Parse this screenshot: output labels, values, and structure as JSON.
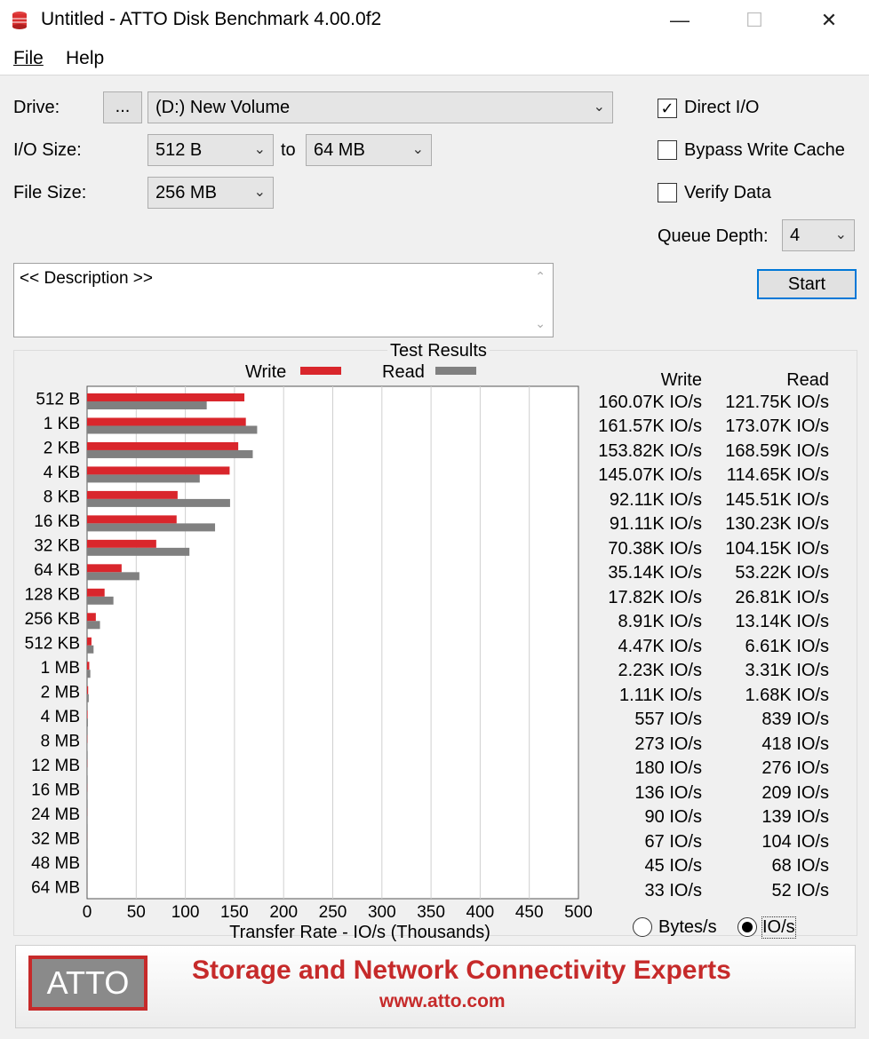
{
  "window": {
    "title": "Untitled - ATTO Disk Benchmark 4.00.0f2",
    "min": "—",
    "max": "☐",
    "close": "✕"
  },
  "menu": {
    "file": "File",
    "help": "Help"
  },
  "drive": {
    "label": "Drive:",
    "browse": "...",
    "value": "(D:) New Volume"
  },
  "io_size": {
    "label": "I/O Size:",
    "from": "512 B",
    "to_label": "to",
    "to": "64 MB"
  },
  "file_size": {
    "label": "File Size:",
    "value": "256 MB"
  },
  "options": {
    "direct_io": {
      "label": "Direct I/O",
      "checked": true
    },
    "bypass_write_cache": {
      "label": "Bypass Write Cache",
      "checked": false
    },
    "verify_data": {
      "label": "Verify Data",
      "checked": false
    },
    "queue_depth": {
      "label": "Queue Depth:",
      "value": "4"
    }
  },
  "start_label": "Start",
  "description": "<< Description >>",
  "results": {
    "title": "Test Results",
    "write_header": "Write",
    "read_header": "Read",
    "rows": [
      {
        "size": "512 B",
        "write": "160.07K IO/s",
        "read": "121.75K IO/s"
      },
      {
        "size": "1 KB",
        "write": "161.57K IO/s",
        "read": "173.07K IO/s"
      },
      {
        "size": "2 KB",
        "write": "153.82K IO/s",
        "read": "168.59K IO/s"
      },
      {
        "size": "4 KB",
        "write": "145.07K IO/s",
        "read": "114.65K IO/s"
      },
      {
        "size": "8 KB",
        "write": "92.11K IO/s",
        "read": "145.51K IO/s"
      },
      {
        "size": "16 KB",
        "write": "91.11K IO/s",
        "read": "130.23K IO/s"
      },
      {
        "size": "32 KB",
        "write": "70.38K IO/s",
        "read": "104.15K IO/s"
      },
      {
        "size": "64 KB",
        "write": "35.14K IO/s",
        "read": "53.22K IO/s"
      },
      {
        "size": "128 KB",
        "write": "17.82K IO/s",
        "read": "26.81K IO/s"
      },
      {
        "size": "256 KB",
        "write": "8.91K IO/s",
        "read": "13.14K IO/s"
      },
      {
        "size": "512 KB",
        "write": "4.47K IO/s",
        "read": "6.61K IO/s"
      },
      {
        "size": "1 MB",
        "write": "2.23K IO/s",
        "read": "3.31K IO/s"
      },
      {
        "size": "2 MB",
        "write": "1.11K IO/s",
        "read": "1.68K IO/s"
      },
      {
        "size": "4 MB",
        "write": "557 IO/s",
        "read": "839 IO/s"
      },
      {
        "size": "8 MB",
        "write": "273 IO/s",
        "read": "418 IO/s"
      },
      {
        "size": "12 MB",
        "write": "180 IO/s",
        "read": "276 IO/s"
      },
      {
        "size": "16 MB",
        "write": "136 IO/s",
        "read": "209 IO/s"
      },
      {
        "size": "24 MB",
        "write": "90 IO/s",
        "read": "139 IO/s"
      },
      {
        "size": "32 MB",
        "write": "67 IO/s",
        "read": "104 IO/s"
      },
      {
        "size": "48 MB",
        "write": "45 IO/s",
        "read": "68 IO/s"
      },
      {
        "size": "64 MB",
        "write": "33 IO/s",
        "read": "52 IO/s"
      }
    ]
  },
  "units": {
    "bytes_label": "Bytes/s",
    "ios_label": "IO/s",
    "selected": "IO/s"
  },
  "chart_data": {
    "type": "bar",
    "orientation": "horizontal",
    "xlabel": "Transfer Rate - IO/s (Thousands)",
    "xlim": [
      0,
      500
    ],
    "xticks": [
      0,
      50,
      100,
      150,
      200,
      250,
      300,
      350,
      400,
      450,
      500
    ],
    "grid": true,
    "legend": "top",
    "categories": [
      "512 B",
      "1 KB",
      "2 KB",
      "4 KB",
      "8 KB",
      "16 KB",
      "32 KB",
      "64 KB",
      "128 KB",
      "256 KB",
      "512 KB",
      "1 MB",
      "2 MB",
      "4 MB",
      "8 MB",
      "12 MB",
      "16 MB",
      "24 MB",
      "32 MB",
      "48 MB",
      "64 MB"
    ],
    "series": [
      {
        "name": "Write",
        "color": "#d9262c",
        "values": [
          160.07,
          161.57,
          153.82,
          145.07,
          92.11,
          91.11,
          70.38,
          35.14,
          17.82,
          8.91,
          4.47,
          2.23,
          1.11,
          0.557,
          0.273,
          0.18,
          0.136,
          0.09,
          0.067,
          0.045,
          0.033
        ]
      },
      {
        "name": "Read",
        "color": "#808080",
        "values": [
          121.75,
          173.07,
          168.59,
          114.65,
          145.51,
          130.23,
          104.15,
          53.22,
          26.81,
          13.14,
          6.61,
          3.31,
          1.68,
          0.839,
          0.418,
          0.276,
          0.209,
          0.139,
          0.104,
          0.068,
          0.052
        ]
      }
    ]
  },
  "banner": {
    "logo": "ATTO",
    "tagline": "Storage and Network Connectivity Experts",
    "url": "www.atto.com"
  }
}
